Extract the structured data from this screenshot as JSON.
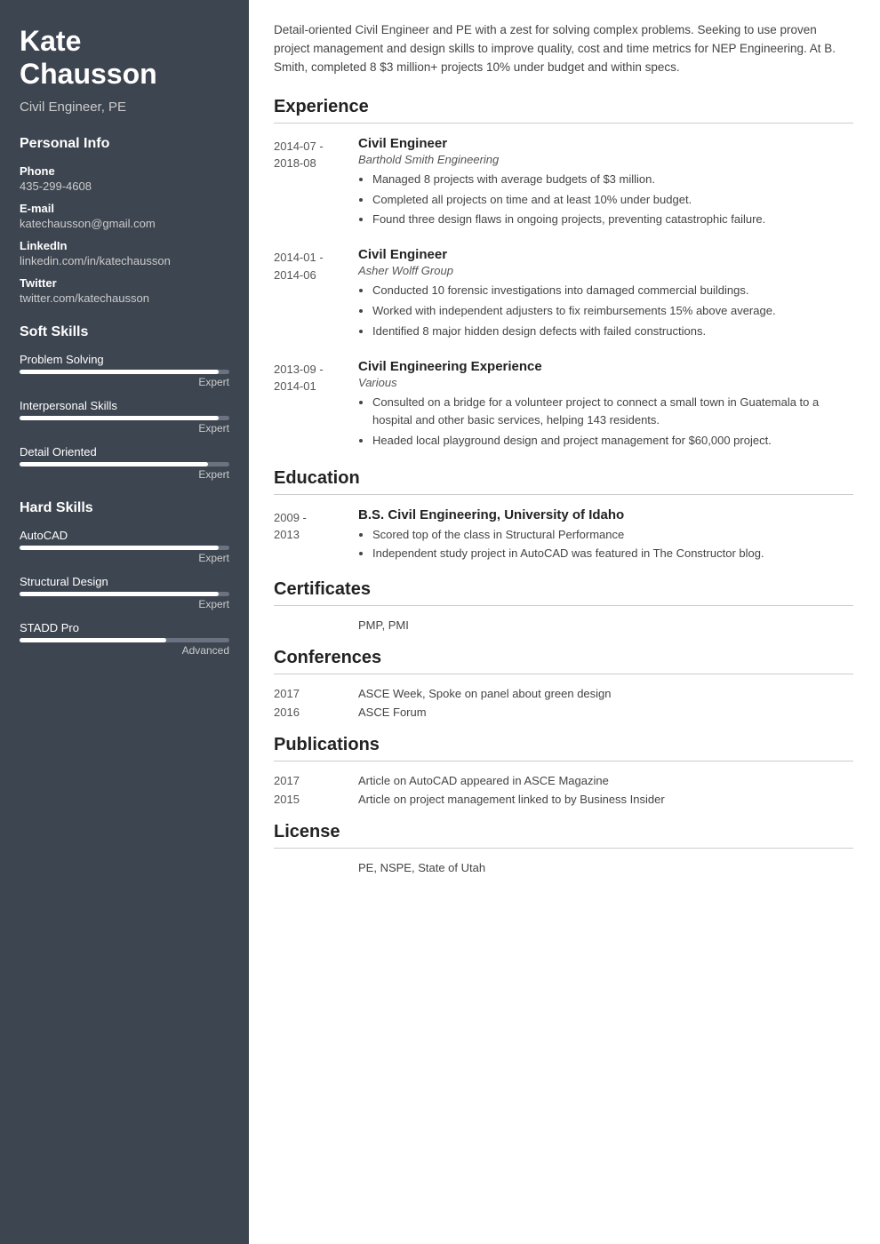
{
  "sidebar": {
    "name": "Kate\nChausson",
    "name_line1": "Kate",
    "name_line2": "Chausson",
    "title": "Civil Engineer, PE",
    "personal_info_label": "Personal Info",
    "phone_label": "Phone",
    "phone_value": "435-299-4608",
    "email_label": "E-mail",
    "email_value": "katechausson@gmail.com",
    "linkedin_label": "LinkedIn",
    "linkedin_value": "linkedin.com/in/katechausson",
    "twitter_label": "Twitter",
    "twitter_value": "twitter.com/katechausson",
    "soft_skills_label": "Soft Skills",
    "soft_skills": [
      {
        "name": "Problem Solving",
        "level": "Expert",
        "pct": 95
      },
      {
        "name": "Interpersonal Skills",
        "level": "Expert",
        "pct": 95
      },
      {
        "name": "Detail Oriented",
        "level": "Expert",
        "pct": 90
      }
    ],
    "hard_skills_label": "Hard Skills",
    "hard_skills": [
      {
        "name": "AutoCAD",
        "level": "Expert",
        "pct": 95
      },
      {
        "name": "Structural Design",
        "level": "Expert",
        "pct": 95
      },
      {
        "name": "STADD Pro",
        "level": "Advanced",
        "pct": 70
      }
    ]
  },
  "main": {
    "summary": "Detail-oriented Civil Engineer and PE with a zest for solving complex problems. Seeking to use proven project management and design skills to improve quality, cost and time metrics for NEP Engineering. At B. Smith, completed 8 $3 million+ projects 10% under budget and within specs.",
    "experience_label": "Experience",
    "experiences": [
      {
        "date": "2014-07 -\n2018-08",
        "job_title": "Civil Engineer",
        "company": "Barthold Smith Engineering",
        "bullets": [
          "Managed 8 projects with average budgets of $3 million.",
          "Completed all projects on time and at least 10% under budget.",
          "Found three design flaws in ongoing projects, preventing catastrophic failure."
        ]
      },
      {
        "date": "2014-01 -\n2014-06",
        "job_title": "Civil Engineer",
        "company": "Asher Wolff Group",
        "bullets": [
          "Conducted 10 forensic investigations into damaged commercial buildings.",
          "Worked with independent adjusters to fix reimbursements 15% above average.",
          "Identified 8 major hidden design defects with failed constructions."
        ]
      },
      {
        "date": "2013-09 -\n2014-01",
        "job_title": "Civil Engineering Experience",
        "company": "Various",
        "bullets": [
          "Consulted on a bridge for a volunteer project to connect a small town in Guatemala to a hospital and other basic services, helping 143 residents.",
          "Headed local playground design and project management for $60,000 project."
        ]
      }
    ],
    "education_label": "Education",
    "educations": [
      {
        "date": "2009 -\n2013",
        "degree": "B.S. Civil Engineering, University of Idaho",
        "bullets": [
          "Scored top of the class in Structural Performance",
          "Independent study project in AutoCAD was featured in The Constructor blog."
        ]
      }
    ],
    "certificates_label": "Certificates",
    "certificates": "PMP, PMI",
    "conferences_label": "Conferences",
    "conferences": [
      {
        "year": "2017",
        "desc": "ASCE Week, Spoke on panel about green design"
      },
      {
        "year": "2016",
        "desc": "ASCE Forum"
      }
    ],
    "publications_label": "Publications",
    "publications": [
      {
        "year": "2017",
        "desc": "Article on AutoCAD appeared in ASCE Magazine"
      },
      {
        "year": "2015",
        "desc": "Article on project management linked to by Business Insider"
      }
    ],
    "license_label": "License",
    "license": "PE, NSPE, State of Utah"
  }
}
